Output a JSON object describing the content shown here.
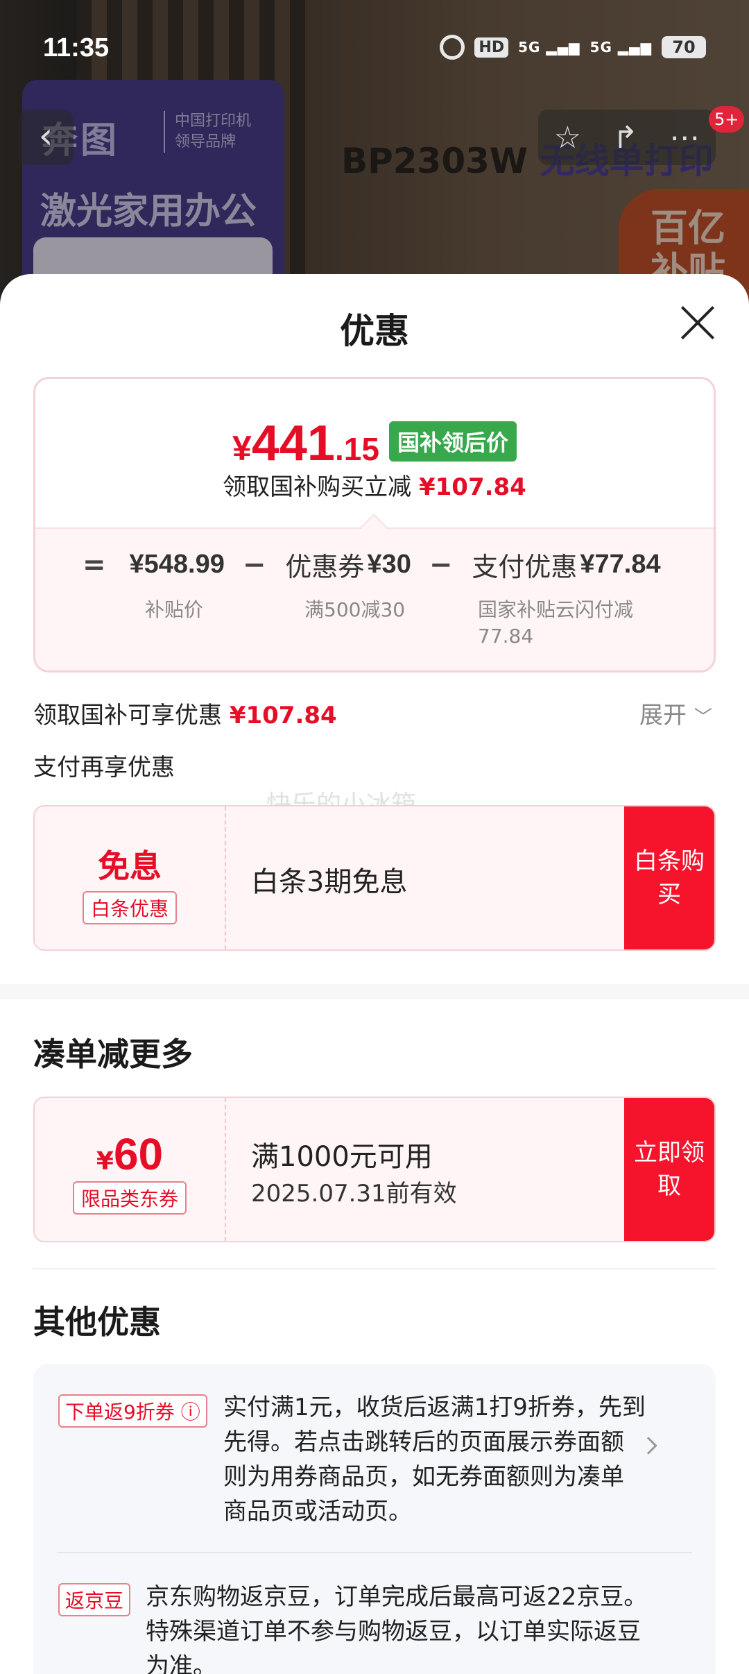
{
  "status_bar": {
    "time": "11:35",
    "hd": "HD",
    "sig1": "5G",
    "sig2": "5G",
    "battery": "70"
  },
  "background": {
    "brand": "奔图",
    "brand_sub_1": "中国打印机",
    "brand_sub_2": "领导品牌",
    "tagline": "激光家用办公",
    "model": "BP2303W",
    "model_accent": "无线单打印",
    "subsidy_1": "百亿",
    "subsidy_2": "补贴",
    "notif_badge": "5+"
  },
  "sheet": {
    "title": "优惠",
    "price_card": {
      "yen": "¥",
      "price_int": "441",
      "price_dec": ".15",
      "price_tag": "国补领后价",
      "sub_prefix": "领取国补购买立减",
      "sub_amount": "¥107.84",
      "eq": "=",
      "base_price": "¥548.99",
      "base_note": "补贴价",
      "minus1": "−",
      "coupon_label": "优惠券",
      "coupon_value": "¥30",
      "coupon_note": "满500减30",
      "minus2": "−",
      "pay_label": "支付优惠",
      "pay_value": "¥77.84",
      "pay_note_1": "国家补贴云闪付减",
      "pay_note_2": "77.84"
    },
    "gov_line": {
      "label": "领取国补可享优惠",
      "amount": "¥107.84",
      "expand": "展开"
    },
    "pay_again": "支付再享优惠",
    "watermark": "快乐的小冰箱",
    "baitiao": {
      "big": "免息",
      "tag": "白条优惠",
      "desc": "白条3期免息",
      "btn": "白条购买"
    },
    "combine": {
      "title": "凑单减更多",
      "yen": "¥",
      "amount": "60",
      "tag": "限品类东券",
      "desc": "满1000元可用",
      "expiry": "2025.07.31前有效",
      "btn": "立即领取"
    },
    "other": {
      "title": "其他优惠",
      "items": [
        {
          "tag": "下单返9折券",
          "text": "实付满1元，收货后返满1打9折券，先到先得。若点击跳转后的页面展示券面额则为用券商品页，如无券面额则为凑单商品页或活动页。"
        },
        {
          "tag": "返京豆",
          "text": "京东购物返京豆，订单完成后最高可返22京豆。特殊渠道订单不参与购物返豆，以订单实际返豆为准。"
        }
      ]
    }
  }
}
